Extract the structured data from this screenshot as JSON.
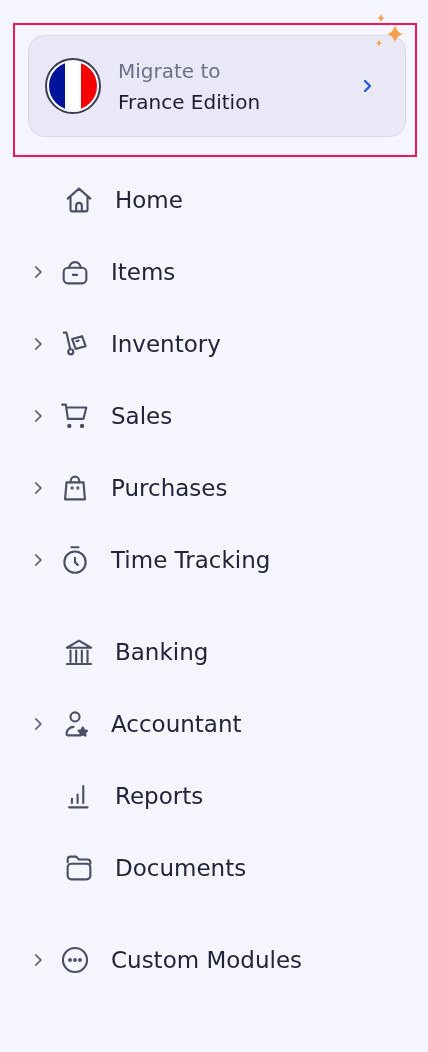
{
  "migrate_banner": {
    "line_1": "Migrate to",
    "line_2": "France Edition",
    "highlighted": true
  },
  "nav_groups": [
    {
      "items": [
        {
          "label": "Home",
          "expandable": false
        },
        {
          "label": "Items",
          "expandable": true
        },
        {
          "label": "Inventory",
          "expandable": true
        },
        {
          "label": "Sales",
          "expandable": true
        },
        {
          "label": "Purchases",
          "expandable": true
        },
        {
          "label": "Time Tracking",
          "expandable": true
        }
      ]
    },
    {
      "items": [
        {
          "label": "Banking",
          "expandable": false
        },
        {
          "label": "Accountant",
          "expandable": true
        },
        {
          "label": "Reports",
          "expandable": false
        },
        {
          "label": "Documents",
          "expandable": false
        }
      ]
    },
    {
      "items": [
        {
          "label": "Custom Modules",
          "expandable": true
        }
      ]
    }
  ]
}
